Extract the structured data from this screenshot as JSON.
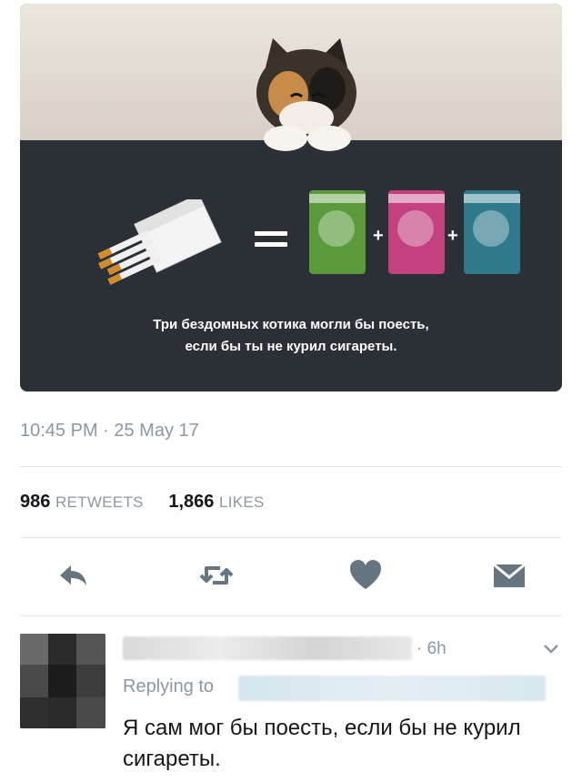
{
  "tweet": {
    "image": {
      "caption_line1": "Три бездомных котика могли бы поесть,",
      "caption_line2": "если бы ты не курил сигареты.",
      "equals": "=",
      "plus": "+"
    },
    "timestamp": "10:45 PM · 25 May 17",
    "retweets_count": "986",
    "retweets_label": "RETWEETS",
    "likes_count": "1,866",
    "likes_label": "LIKES"
  },
  "actions": {
    "reply": "reply-icon",
    "retweet": "retweet-icon",
    "like": "heart-icon",
    "message": "envelope-icon"
  },
  "reply": {
    "time": "6h",
    "replying_label": "Replying to",
    "text": "Я сам мог бы поесть, если бы не курил сигареты."
  },
  "colors": {
    "secondary_text": "#8b98a5",
    "icon": "#66757f",
    "media_bg": "#2b2f36"
  }
}
